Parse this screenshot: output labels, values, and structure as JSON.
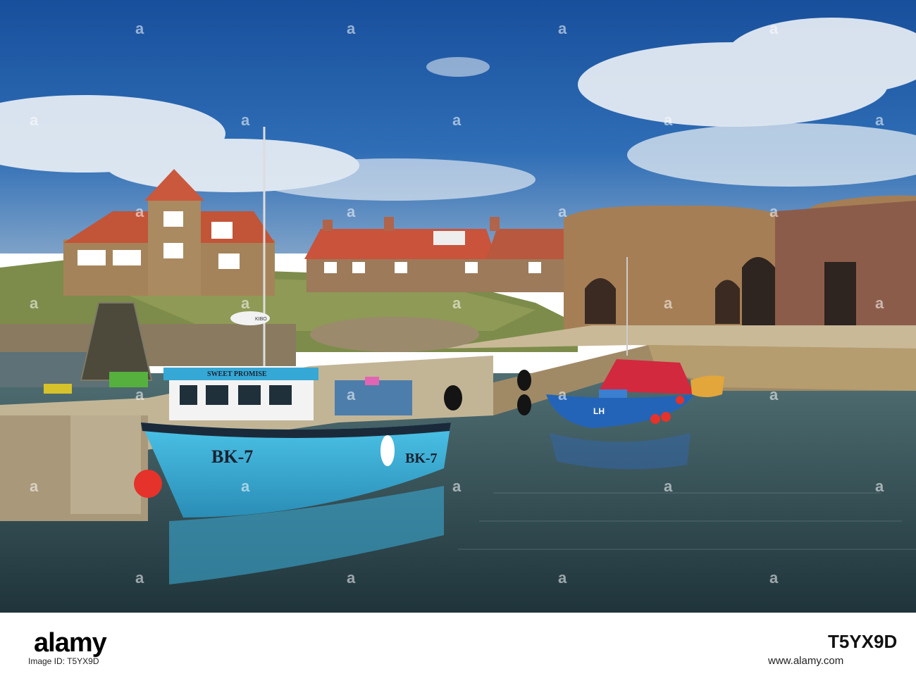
{
  "photo": {
    "boat_main_registration": "BK-7",
    "boat_main_registration_stern": "BK-7",
    "boat_main_name": "SWEET PROMISE",
    "boat_radar_text": "KIBO",
    "boat_small_registration": "LH",
    "watermark_glyph": "a",
    "colors": {
      "sky": "#1f5fae",
      "water": "#2c4a55",
      "boat_hull": "#3db3dc",
      "roof": "#c9523a",
      "stone": "#a07a52"
    }
  },
  "footer": {
    "logo": "alamy",
    "stock_id_label": "Image ID: T5YX9D",
    "stock_id": "T5YX9D",
    "site_url": "www.alamy.com"
  }
}
